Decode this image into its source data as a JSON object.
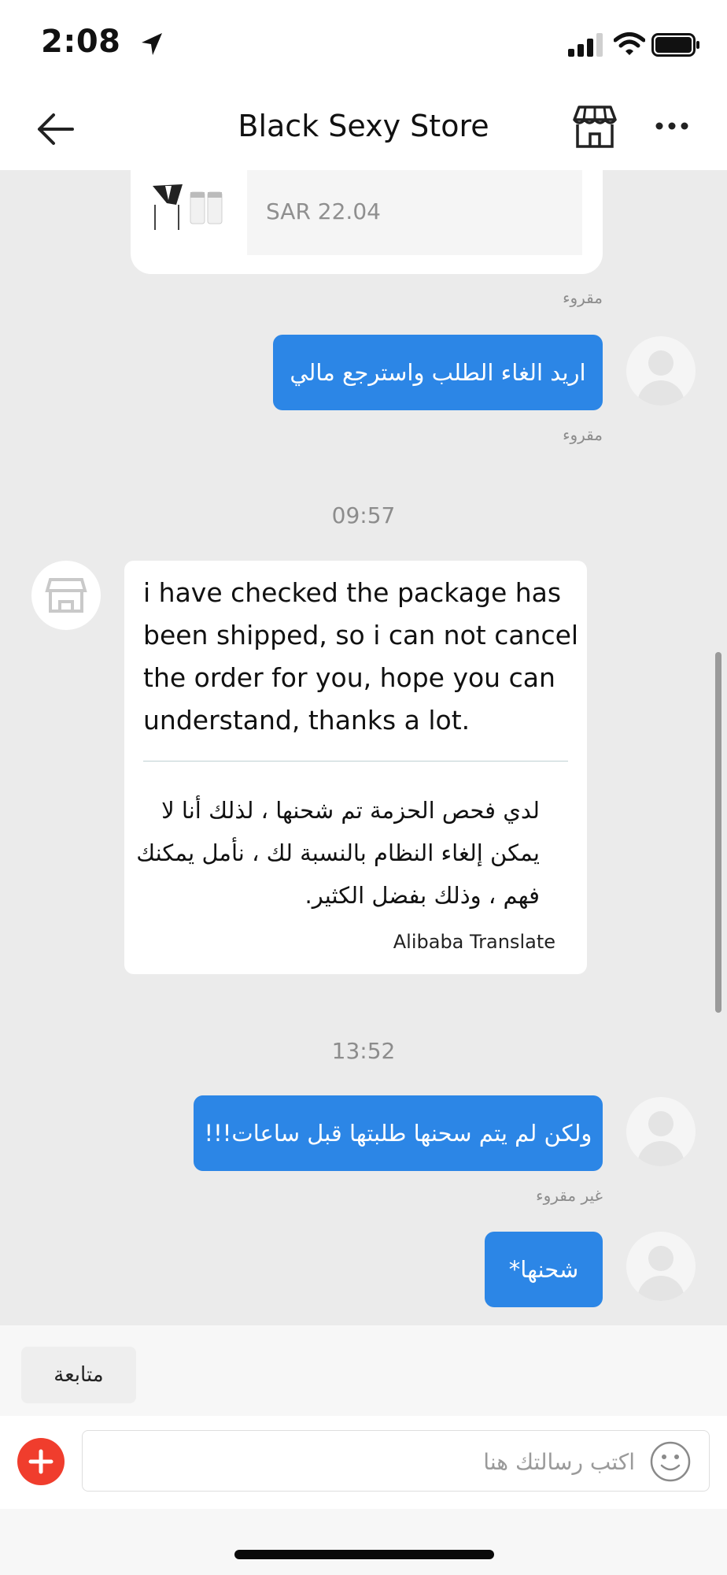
{
  "status_bar": {
    "time": "2:08"
  },
  "header": {
    "title": "Black Sexy Store"
  },
  "product_card": {
    "price": "SAR 22.04"
  },
  "messages": [
    {
      "text": "اريد الغاء الطلب واسترجع مالي",
      "status_above": "مقروء",
      "status_below": "مقروء"
    },
    {
      "timestamp": "09:57",
      "text": "i have checked the package has been shipped, so i can not cancel the order for you, hope you can understand, thanks a lot.",
      "text_lines": [
        "i have checked the package has",
        "been shipped, so i can not cancel",
        "the order for you, hope you can",
        "understand, thanks a lot."
      ],
      "translation_lines": [
        "لدي فحص الحزمة تم شحنها ، لذلك أنا لا",
        "يمكن إلغاء النظام بالنسبة لك ، نأمل يمكنك",
        "فهم ، وذلك بفضل الكثير."
      ],
      "translate_credit": "Alibaba Translate"
    },
    {
      "timestamp": "13:52",
      "text": "ولكن لم يتم سحنها طلبتها قبل ساعات!!!",
      "status_below": "غير مقروء"
    },
    {
      "text": "شحنها*"
    }
  ],
  "bottom": {
    "follow_label": "متابعة",
    "input_placeholder": "اكتب رسالتك هنا"
  },
  "colors": {
    "accent": "#2c86e6",
    "plus": "#f03d2d",
    "background": "#ebebeb"
  },
  "icons": [
    "back-arrow-icon",
    "store-icon",
    "more-icon",
    "location-arrow-icon",
    "signal-icon",
    "wifi-icon",
    "battery-icon",
    "plus-icon",
    "emoji-icon"
  ]
}
